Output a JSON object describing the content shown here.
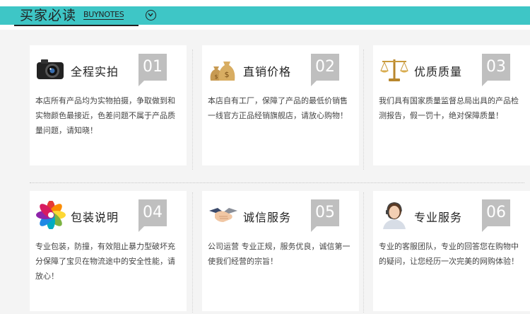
{
  "header": {
    "title": "买家必读",
    "subtitle": "BUYNOTES"
  },
  "cards": [
    {
      "number": "01",
      "title": "全程实拍",
      "text": "本店所有产品均为实物拍摄，争取做到和实物颜色最接近，色差问题不属于产品质量问题，请知晓！",
      "icon": "camera-icon"
    },
    {
      "number": "02",
      "title": "直销价格",
      "text": "本店自有工厂，保障了产品的最低价销售一线官方正品经销旗舰店，请放心购物！",
      "icon": "money-bags-icon"
    },
    {
      "number": "03",
      "title": "优质质量",
      "text": "我们具有国家质量监督总局出具的产品检测报告，假一罚十，绝对保障质量！",
      "icon": "scales-icon"
    },
    {
      "number": "04",
      "title": "包装说明",
      "text": "专业包装，防撞，有效阻止暴力型破坏充分保障了宝贝在物流途中的安全性能，请放心！",
      "icon": "color-petals-icon"
    },
    {
      "number": "05",
      "title": "诚信服务",
      "text": "公司运营 专业正规，服务优良，诚信第一使我们经营的宗旨！",
      "icon": "handshake-icon"
    },
    {
      "number": "06",
      "title": "专业服务",
      "text": "专业的客服团队，专业的回答您在购物中的疑问，让您经历一次完美的网购体验！",
      "icon": "headset-agent-icon"
    }
  ]
}
